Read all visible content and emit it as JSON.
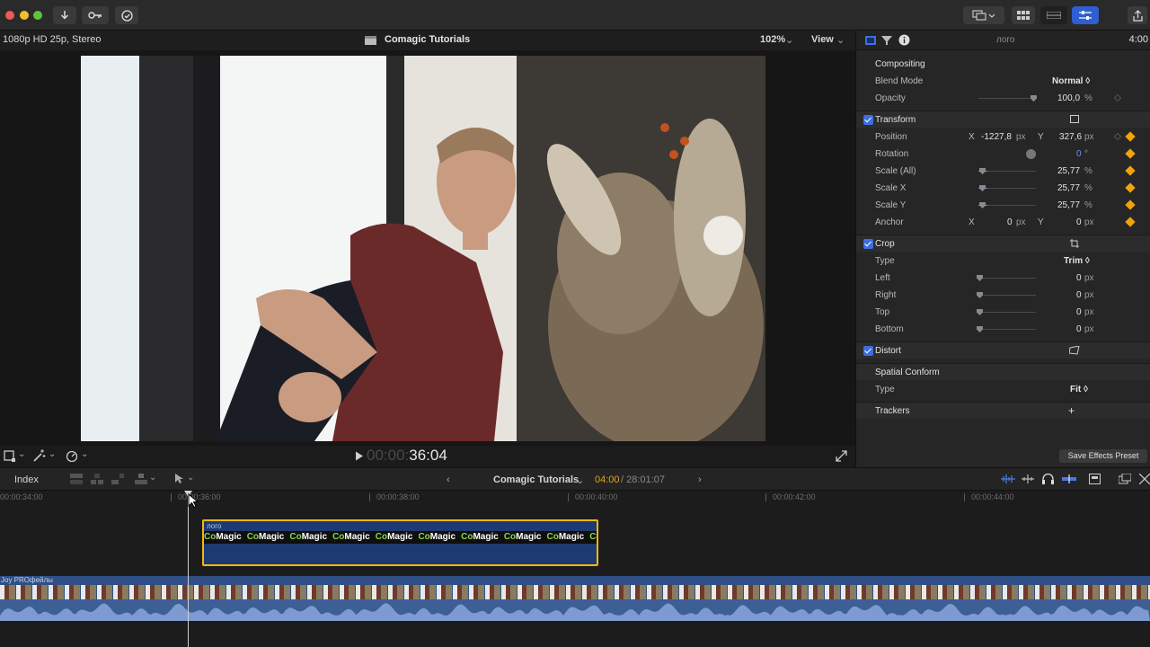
{
  "toolbar": {
    "buttons": [
      "import-icon",
      "keyword-icon",
      "background-tasks-icon"
    ],
    "right_buttons": [
      "workspace-icon",
      "browser-icon",
      "timeline-icon",
      "inspector-icon",
      "share-icon"
    ]
  },
  "viewer": {
    "format": "1080p HD 25p, Stereo",
    "project_title": "Comagic Tutorials",
    "zoom": "102%",
    "view_menu": "View",
    "timecode_dim": "00:00:",
    "timecode": "36:04"
  },
  "inspector": {
    "clip_name": "лого",
    "duration": "4:00",
    "compositing": {
      "title": "Compositing",
      "blend_mode_label": "Blend Mode",
      "blend_mode_value": "Normal ◊",
      "opacity_label": "Opacity",
      "opacity_value": "100,0",
      "opacity_unit": "%"
    },
    "transform": {
      "title": "Transform",
      "position_label": "Position",
      "position_x_label": "X",
      "position_x": "-1227,8",
      "position_y_label": "Y",
      "position_y": "327,6",
      "unit_px": "px",
      "rotation_label": "Rotation",
      "rotation_value": "0",
      "rotation_unit": "°",
      "scale_all_label": "Scale (All)",
      "scale_all": "25,77",
      "scale_x_label": "Scale X",
      "scale_x": "25,77",
      "scale_y_label": "Scale Y",
      "scale_y": "25,77",
      "unit_pct": "%",
      "anchor_label": "Anchor",
      "anchor_x_label": "X",
      "anchor_x": "0",
      "anchor_y_label": "Y",
      "anchor_y": "0"
    },
    "crop": {
      "title": "Crop",
      "type_label": "Type",
      "type_value": "Trim ◊",
      "left_label": "Left",
      "left": "0",
      "right_label": "Right",
      "right": "0",
      "top_label": "Top",
      "top": "0",
      "bottom_label": "Bottom",
      "bottom": "0",
      "unit": "px"
    },
    "distort": {
      "title": "Distort"
    },
    "spatial_conform": {
      "title": "Spatial Conform",
      "type_label": "Type",
      "type_value": "Fit ◊"
    },
    "trackers": {
      "title": "Trackers",
      "add": "+"
    },
    "save_preset": "Save Effects Preset"
  },
  "timeline": {
    "index_label": "Index",
    "project_name": "Comagic Tutorials",
    "position": "04:00",
    "total_duration": "/ 28:01:07",
    "ruler_labels": [
      "00:00:34:00",
      "00:00:36:00",
      "00:00:38:00",
      "00:00:40:00",
      "00:00:42:00",
      "00:00:44:00"
    ],
    "title_clip_name": "лого",
    "title_clip_text": "CoMagic",
    "main_clip_name": "Joy PROфейлы"
  },
  "colors": {
    "accent_blue": "#3d6ee0",
    "keyframe": "#f0a30a",
    "selection_yellow": "#f2b90c",
    "clip_blue": "#2f4f86"
  }
}
